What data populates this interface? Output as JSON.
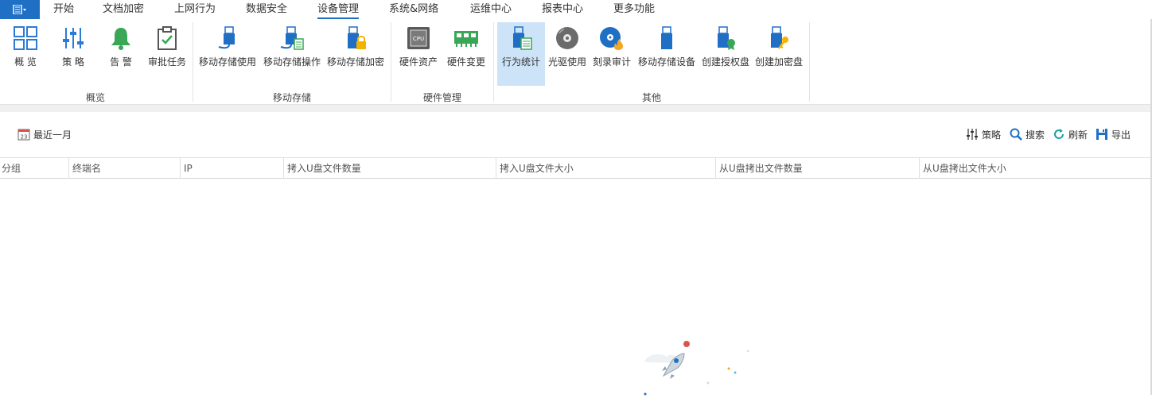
{
  "menu": {
    "tabs": [
      "开始",
      "文档加密",
      "上网行为",
      "数据安全",
      "设备管理",
      "系统&网络",
      "运维中心",
      "报表中心",
      "更多功能"
    ],
    "active_tab": "设备管理"
  },
  "ribbon": {
    "groups": [
      "概览",
      "移动存储",
      "硬件管理",
      "其他"
    ],
    "buttons": [
      "概 览",
      "策 略",
      "告 警",
      "审批任务",
      "移动存储使用",
      "移动存储操作",
      "移动存储加密",
      "硬件资产",
      "硬件变更",
      "行为统计",
      "光驱使用",
      "刻录审计",
      "移动存储设备",
      "创建授权盘",
      "创建加密盘"
    ],
    "selected": "行为统计"
  },
  "toolbar": {
    "date_range": "最近一月",
    "calendar_day": "23",
    "policy": "策略",
    "search": "搜索",
    "refresh": "刷新",
    "export": "导出"
  },
  "table": {
    "columns": [
      "分组",
      "终端名",
      "IP",
      "拷入U盘文件数量",
      "拷入U盘文件大小",
      "从U盘拷出文件数量",
      "从U盘拷出文件大小"
    ]
  },
  "colors": {
    "accent": "#1f6fc5",
    "selected_bg": "#cde3f7",
    "bell_green": "#3aa757"
  },
  "icons": {
    "cpu_label": "CPU"
  }
}
